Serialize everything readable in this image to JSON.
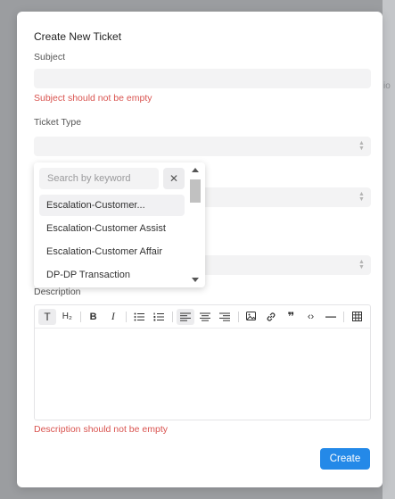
{
  "backdrop": {
    "peek_text": "io"
  },
  "modal": {
    "title": "Create New Ticket",
    "subject": {
      "label": "Subject",
      "value": "",
      "error": "Subject should not be empty"
    },
    "ticket_type": {
      "label": "Ticket Type",
      "value": ""
    },
    "description": {
      "label": "Description",
      "value": "",
      "error": "Description should not be empty"
    },
    "toolbar": {
      "paragraph": "T",
      "heading": "H₂",
      "bold": "B",
      "italic": "I",
      "quote": "❞",
      "code": "‹›"
    },
    "create_label": "Create"
  },
  "dropdown": {
    "search_placeholder": "Search by keyword",
    "clear_glyph": "✕",
    "items": [
      "Escalation-Customer...",
      "Escalation-Customer Assist",
      "Escalation-Customer Affair",
      "DP-DP Transaction"
    ]
  }
}
